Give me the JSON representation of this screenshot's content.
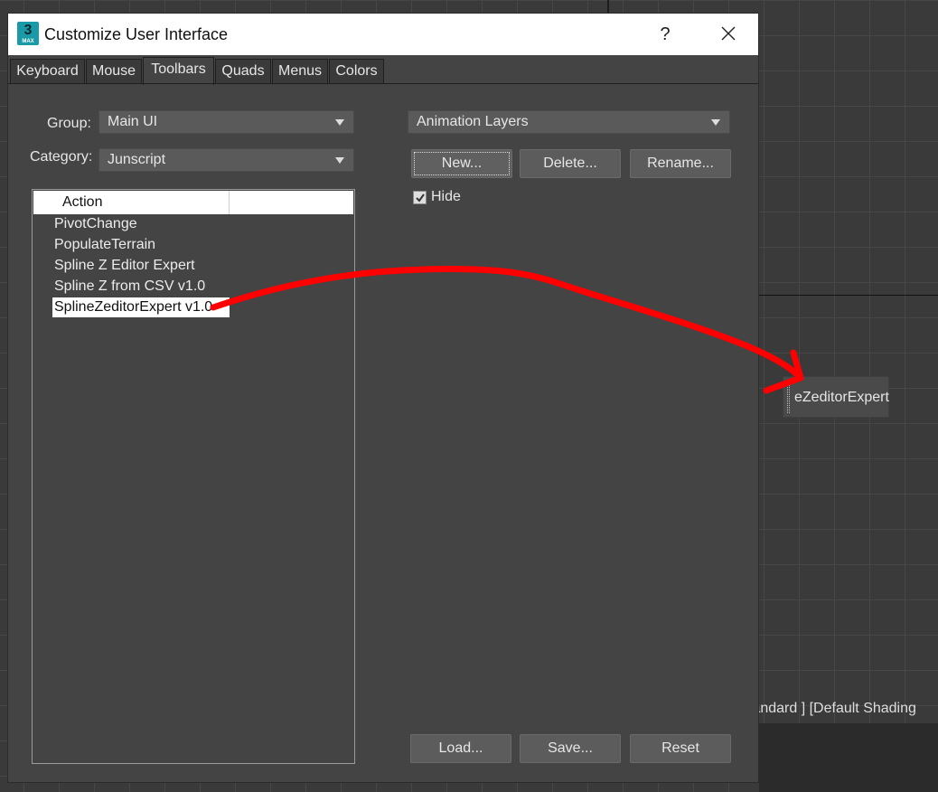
{
  "dialog": {
    "title": "Customize User Interface",
    "app_icon": {
      "glyph": "3",
      "sub": "MAX"
    },
    "help_label": "?",
    "close_icon": "close-icon"
  },
  "tabs": [
    {
      "label": "Keyboard",
      "active": false
    },
    {
      "label": "Mouse",
      "active": false
    },
    {
      "label": "Toolbars",
      "active": true
    },
    {
      "label": "Quads",
      "active": false
    },
    {
      "label": "Menus",
      "active": false
    },
    {
      "label": "Colors",
      "active": false
    }
  ],
  "left": {
    "group_label": "Group:",
    "group_value": "Main UI",
    "category_label": "Category:",
    "category_value": "Junscript",
    "list_header": "Action",
    "actions": [
      {
        "label": "PivotChange",
        "selected": false
      },
      {
        "label": "PopulateTerrain",
        "selected": false
      },
      {
        "label": "Spline Z Editor Expert",
        "selected": false
      },
      {
        "label": "Spline Z from CSV v1.0",
        "selected": false
      },
      {
        "label": "SplineZeditorExpert v1.0",
        "selected": true
      }
    ]
  },
  "right": {
    "toolbar_value": "Animation Layers",
    "new_label": "New...",
    "delete_label": "Delete...",
    "rename_label": "Rename...",
    "hide_label": "Hide",
    "hide_checked": true
  },
  "footer": {
    "load_label": "Load...",
    "save_label": "Save...",
    "reset_label": "Reset"
  },
  "viewport": {
    "label": "tandard ] [Default Shading",
    "floating_toolbar_button": "eZeditorExpert"
  },
  "colors": {
    "annotation": "#ff0000",
    "dialog_bg": "#444444",
    "selection_bg": "#ffffff"
  }
}
